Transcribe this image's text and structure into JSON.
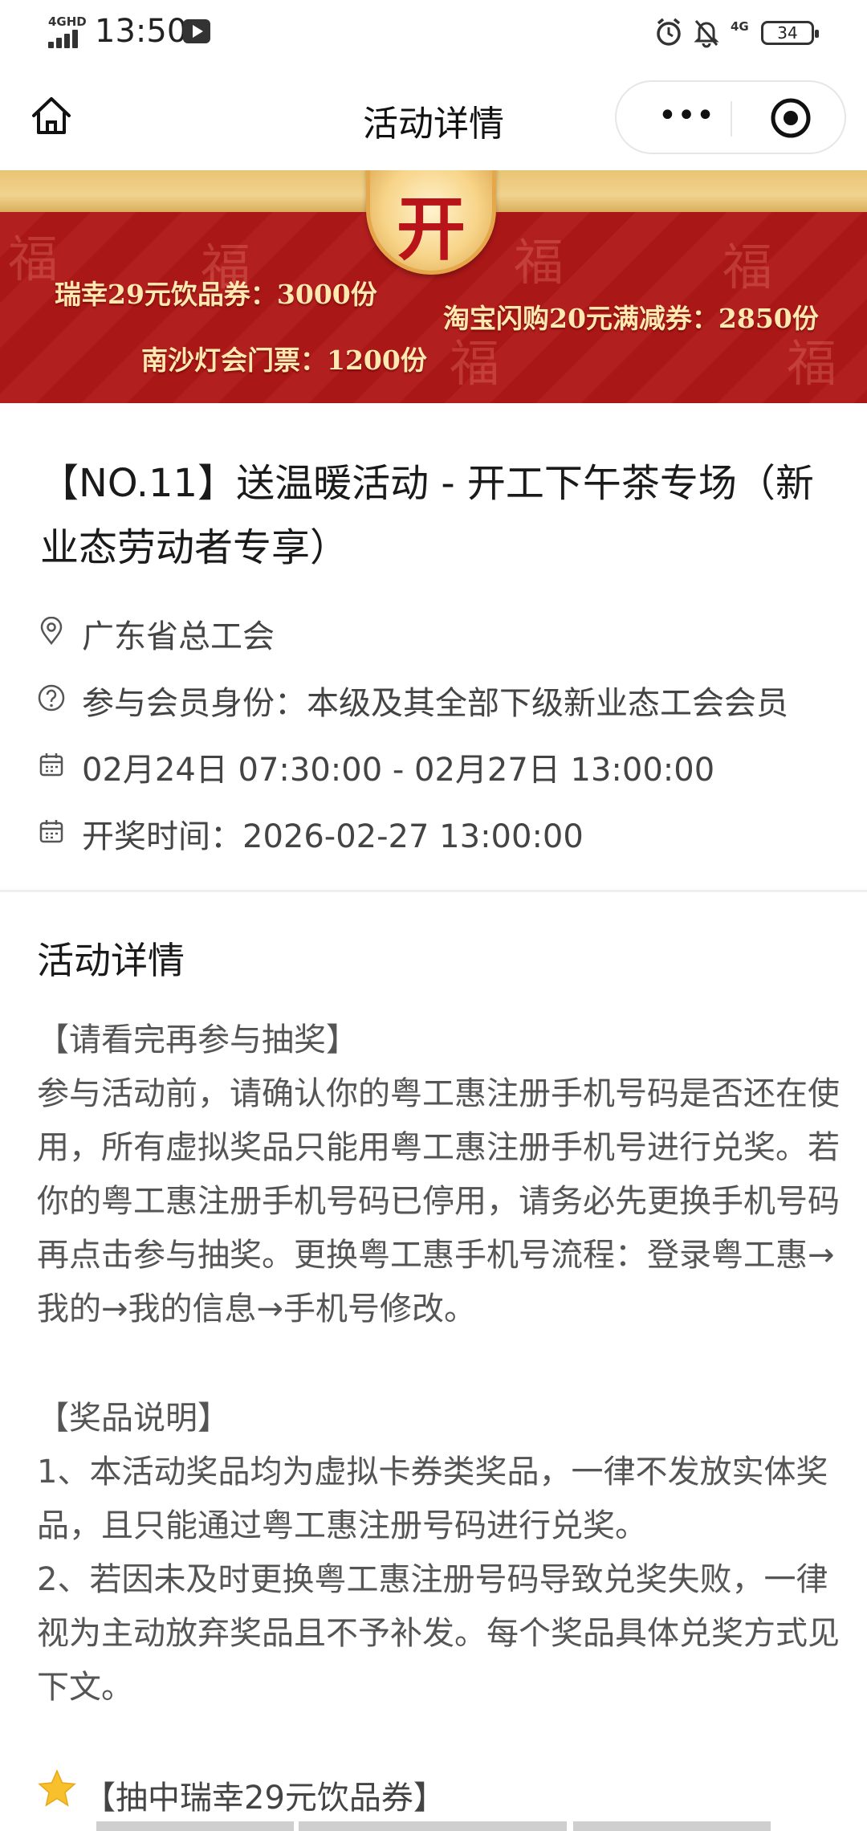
{
  "status_bar": {
    "network_label": "4GHD",
    "time": "13:50",
    "network_label_right": "4G",
    "battery": "34"
  },
  "nav": {
    "title": "活动详情",
    "more_glyph": "•••"
  },
  "banner": {
    "badge": "开",
    "prizes": [
      "瑞幸29元饮品券：3000份",
      "淘宝闪购20元满减券：2850份",
      "南沙灯会门票：1200份"
    ],
    "bg_color": "#b01818",
    "gold_color": "#e9c473"
  },
  "activity": {
    "title": "【NO.11】送温暖活动 - 开工下午茶专场（新业态劳动者专享）",
    "organizer": "广东省总工会",
    "member_identity": "参与会员身份：本级及其全部下级新业态工会会员",
    "time_range": "02月24日 07:30:00 - 02月27日 13:00:00",
    "draw_time": "开奖时间：2026-02-27 13:00:00"
  },
  "details": {
    "section_title": "活动详情",
    "notice_heading": "【请看完再参与抽奖】",
    "notice_body": "参与活动前，请确认你的粤工惠注册手机号码是否还在使用，所有虚拟奖品只能用粤工惠注册手机号进行兑奖。若你的粤工惠注册手机号码已停用，请务必先更换手机号码再点击参与抽奖。更换粤工惠手机号流程：登录粤工惠→我的→我的信息→手机号修改。",
    "prize_heading": "【奖品说明】",
    "prize_item_1": "1、本活动奖品均为虚拟卡券类奖品，一律不发放实体奖品，且只能通过粤工惠注册号码进行兑奖。",
    "prize_item_2": "2、若因未及时更换粤工惠注册号码导致兑奖失败，一律视为主动放弃奖品且不予补发。每个奖品具体兑奖方式见下文。",
    "luckin_heading": "【抽中瑞幸29元饮品券】"
  },
  "icons": {
    "home": "home-icon",
    "location": "location-pin-icon",
    "help": "question-circle-icon",
    "calendar": "calendar-icon",
    "star": "star-icon"
  }
}
